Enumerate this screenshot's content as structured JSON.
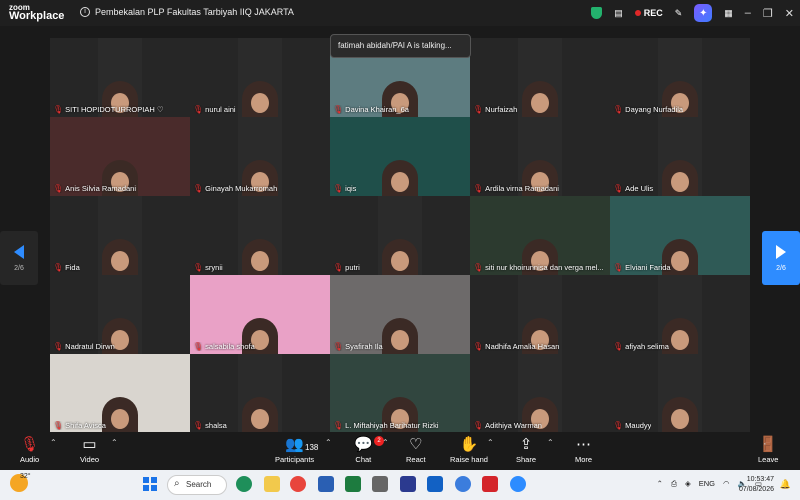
{
  "app": {
    "brand_line1": "zoom",
    "brand_line2": "Workplace",
    "meeting_title": "Pembekalan PLP Fakultas Tarbiyah IIQ JAKARTA",
    "rec_label": "REC"
  },
  "talking_banner": "fatimah abidah/PAI A is talking...",
  "pager": {
    "left_label": "2/6",
    "right_label": "2/6"
  },
  "participants": [
    {
      "name": "SITI HOPIDOTURROPIAH ♡",
      "bg": "#2b2b2b"
    },
    {
      "name": "nurul aini",
      "bg": "#2b2b2b"
    },
    {
      "name": "Davina Khairan_6a",
      "bg": "#5d7c80"
    },
    {
      "name": "Nurfaizah",
      "bg": "#2b2b2b"
    },
    {
      "name": "Dayang Nurfadila",
      "bg": "#2b2b2b"
    },
    {
      "name": "Anis Silvia Ramadani",
      "bg": "#4a2b2b"
    },
    {
      "name": "Ginayah Mukarromah",
      "bg": "#2b2b2b"
    },
    {
      "name": "iqis",
      "bg": "#1f4f4a"
    },
    {
      "name": "Ardila virna Ramadani",
      "bg": "#2b2b2b"
    },
    {
      "name": "Ade Ulis",
      "bg": "#2b2b2b"
    },
    {
      "name": "Fida",
      "bg": "#2b2b2b"
    },
    {
      "name": "srynii",
      "bg": "#2b2b2b"
    },
    {
      "name": "putri",
      "bg": "#2b2b2b"
    },
    {
      "name": "siti nur khoirunnisa dan verga mel...",
      "bg": "#2c3a2f"
    },
    {
      "name": "Elviani Farida",
      "bg": "#2f5a56"
    },
    {
      "name": "Nadratul Dirwn",
      "bg": "#2b2b2b"
    },
    {
      "name": "salsabila shofa",
      "bg": "#e9a1c6"
    },
    {
      "name": "Syafirah Ila",
      "bg": "#6d6a6a"
    },
    {
      "name": "Nadhifa Amalia Hasan",
      "bg": "#2b2b2b"
    },
    {
      "name": "afiyah selima",
      "bg": "#2b2b2b"
    },
    {
      "name": "Shifa Avisca",
      "bg": "#d9d5cf"
    },
    {
      "name": "shalsa",
      "bg": "#2b2b2b"
    },
    {
      "name": "L. Miftahiyah Barihatur Rizki",
      "bg": "#31463f"
    },
    {
      "name": "Adithiya Warman",
      "bg": "#2b2b2b"
    },
    {
      "name": "Maudyy",
      "bg": "#2b2b2b"
    }
  ],
  "toolbar": {
    "audio": "Audio",
    "video": "Video",
    "participants": "Participants",
    "participants_count": "138",
    "chat": "Chat",
    "chat_badge": "2",
    "react": "React",
    "raise_hand": "Raise hand",
    "share": "Share",
    "more": "More",
    "leave": "Leave"
  },
  "taskbar": {
    "temperature": "32°",
    "search_label": "Search",
    "language": "ENG",
    "time": "10:53:47",
    "date": "07/08/2026"
  },
  "colors": {
    "accent": "#2e8cff",
    "rec": "#e02828",
    "mute": "#e33333",
    "leave": "#e02828"
  }
}
